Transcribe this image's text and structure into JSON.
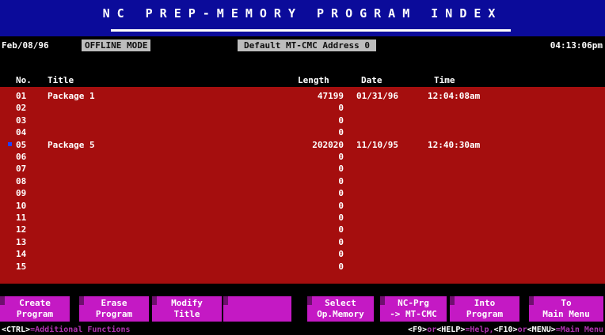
{
  "title": "NC PREP-MEMORY PROGRAM INDEX",
  "status": {
    "date": "Feb/08/96",
    "mode": "OFFLINE MODE",
    "address": "Default MT-CMC Address 0",
    "time": "04:13:06pm"
  },
  "columns": {
    "no": "No.",
    "title": "Title",
    "length": "Length",
    "date": "Date",
    "time": "Time"
  },
  "rows": [
    {
      "no": "01",
      "title": "Package 1",
      "length": "47199",
      "date": "01/31/96",
      "time": "12:04:08am"
    },
    {
      "no": "02",
      "title": "",
      "length": "0",
      "date": "",
      "time": ""
    },
    {
      "no": "03",
      "title": "",
      "length": "0",
      "date": "",
      "time": ""
    },
    {
      "no": "04",
      "title": "",
      "length": "0",
      "date": "",
      "time": ""
    },
    {
      "no": "05",
      "title": "Package 5",
      "length": "202020",
      "date": "11/10/95",
      "time": "12:40:30am"
    },
    {
      "no": "06",
      "title": "",
      "length": "0",
      "date": "",
      "time": ""
    },
    {
      "no": "07",
      "title": "",
      "length": "0",
      "date": "",
      "time": ""
    },
    {
      "no": "08",
      "title": "",
      "length": "0",
      "date": "",
      "time": ""
    },
    {
      "no": "09",
      "title": "",
      "length": "0",
      "date": "",
      "time": ""
    },
    {
      "no": "10",
      "title": "",
      "length": "0",
      "date": "",
      "time": ""
    },
    {
      "no": "11",
      "title": "",
      "length": "0",
      "date": "",
      "time": ""
    },
    {
      "no": "12",
      "title": "",
      "length": "0",
      "date": "",
      "time": ""
    },
    {
      "no": "13",
      "title": "",
      "length": "0",
      "date": "",
      "time": ""
    },
    {
      "no": "14",
      "title": "",
      "length": "0",
      "date": "",
      "time": ""
    },
    {
      "no": "15",
      "title": "",
      "length": "0",
      "date": "",
      "time": ""
    }
  ],
  "selected_row": "05",
  "fkeys": [
    {
      "label": "Create\nProgram"
    },
    {
      "label": "Erase\nProgram"
    },
    {
      "label": "Modify\nTitle"
    },
    {
      "label": ""
    },
    {
      "label": "Select\nOp.Memory"
    },
    {
      "label": "NC-Prg\n-> MT-CMC"
    },
    {
      "label": "Into\nProgram"
    },
    {
      "label": "To\nMain Menu"
    }
  ],
  "help": {
    "left_key": "<CTRL>",
    "left_desc": "=Additional Functions",
    "right_parts": [
      {
        "key": "<F9>",
        "desc": "or"
      },
      {
        "key": "<HELP>",
        "desc": "=Help,"
      },
      {
        "key": "<F10>",
        "desc": "or"
      },
      {
        "key": "<MENU>",
        "desc": "=Main Menu"
      }
    ]
  },
  "colors": {
    "title_bg": "#0b0b9a",
    "list_bg": "#a50e0e",
    "fkey_bg": "#c419c4",
    "status_field_bg": "#bdbdbd"
  }
}
